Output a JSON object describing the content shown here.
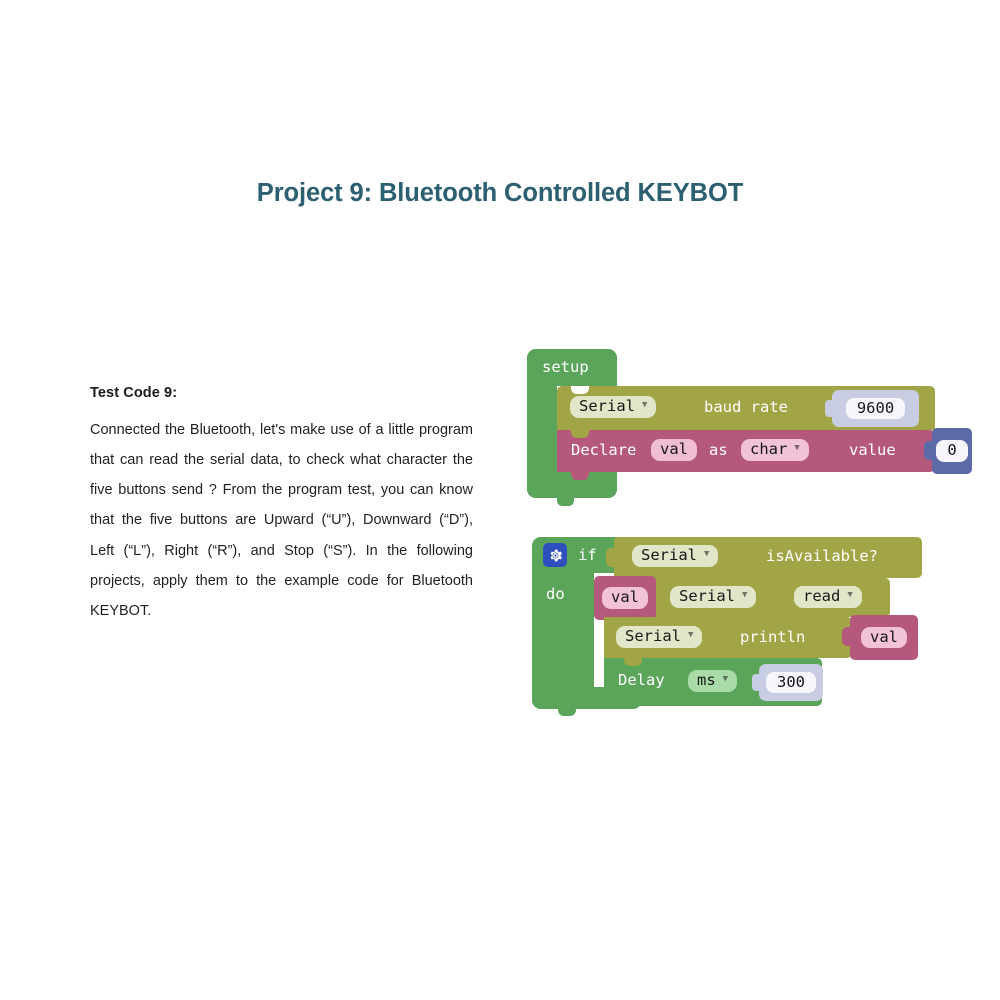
{
  "page": {
    "title": "Project 9: Bluetooth Controlled KEYBOT",
    "title_color": "#2c5f70"
  },
  "article": {
    "heading": "Test Code 9:",
    "paragraph": "Connected the Bluetooth, let's make use of a little program that can read the serial data, to check what character the five buttons send ? From the program test, you can know that the five buttons are Upward (“U”), Downward (“D”), Left (“L”), Right (“R”), and Stop (“S”). In the following projects, apply them to the example code for Bluetooth KEYBOT."
  },
  "colors": {
    "control_green": "#5ba55b",
    "serial_olive": "#a1a546",
    "variable_mauve": "#b5587d",
    "number_blue": "#5c6ba7",
    "input_lavender": "#c8cde3",
    "gear_blue": "#2f4fbe"
  },
  "blocks": {
    "setup": {
      "label": "setup",
      "statements": [
        {
          "id": "serial-baud-rate",
          "category": "serial",
          "dropdown": "Serial",
          "text": "baud rate",
          "value": "9600"
        },
        {
          "id": "declare-variable",
          "category": "variable",
          "text_declare": "Declare",
          "variable": "val",
          "text_as": "as",
          "type": "char",
          "text_value": "value",
          "value": "0"
        }
      ]
    },
    "if_block": {
      "gear_icon": "gear-icon",
      "label_if": "if",
      "label_do": "do",
      "condition": {
        "dropdown": "Serial",
        "text": "isAvailable?"
      },
      "statements": [
        {
          "id": "set-val-serial-read",
          "variable": "val",
          "dropdown": "Serial",
          "method": "read"
        },
        {
          "id": "serial-println",
          "dropdown": "Serial",
          "text": "println",
          "argument": "val"
        },
        {
          "id": "delay",
          "text": "Delay",
          "unit": "ms",
          "value": "300"
        }
      ]
    }
  },
  "glyphs": {
    "caret_down": "▼"
  }
}
